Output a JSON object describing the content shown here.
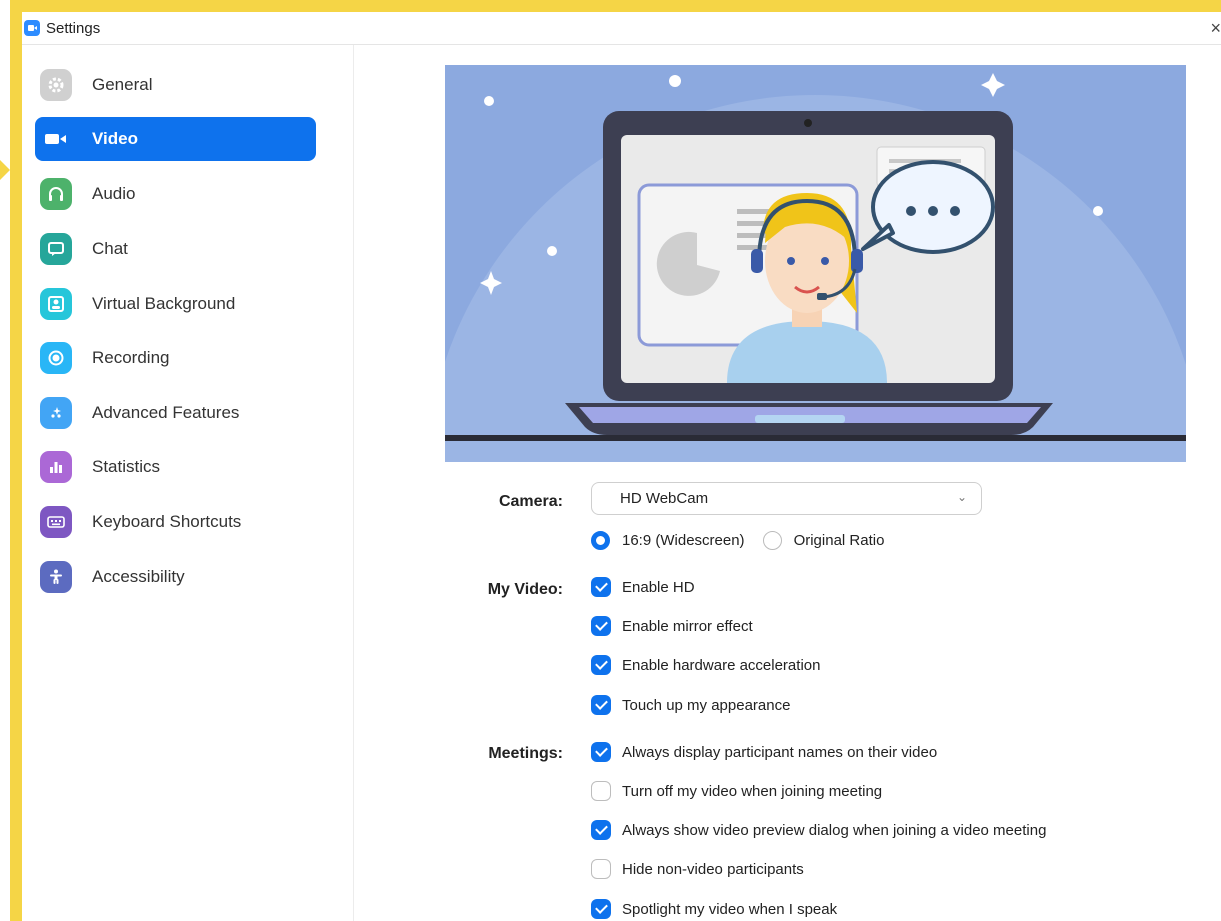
{
  "window": {
    "title": "Settings",
    "close_glyph": "×"
  },
  "sidebar": {
    "items": [
      {
        "label": "General",
        "icon": "gear-icon",
        "color": "#c8c8c8",
        "active": false
      },
      {
        "label": "Video",
        "icon": "video-camera-icon",
        "color": "#0e72ed",
        "active": true
      },
      {
        "label": "Audio",
        "icon": "headphones-icon",
        "color": "#4db26b",
        "active": false
      },
      {
        "label": "Chat",
        "icon": "chat-bubble-icon",
        "color": "#26a69a",
        "active": false
      },
      {
        "label": "Virtual Background",
        "icon": "person-frame-icon",
        "color": "#26c6da",
        "active": false
      },
      {
        "label": "Recording",
        "icon": "record-icon",
        "color": "#29b6f6",
        "active": false
      },
      {
        "label": "Advanced Features",
        "icon": "sparkle-icon",
        "color": "#42a5f5",
        "active": false
      },
      {
        "label": "Statistics",
        "icon": "bar-chart-icon",
        "color": "#ab68d6",
        "active": false
      },
      {
        "label": "Keyboard Shortcuts",
        "icon": "keyboard-icon",
        "color": "#7e57c2",
        "active": false
      },
      {
        "label": "Accessibility",
        "icon": "accessibility-icon",
        "color": "#5c6bc0",
        "active": false
      }
    ]
  },
  "camera": {
    "label": "Camera:",
    "selected": "HD WebCam",
    "ratio_options": [
      {
        "label": "16:9 (Widescreen)",
        "selected": true
      },
      {
        "label": "Original Ratio",
        "selected": false
      }
    ]
  },
  "my_video": {
    "label": "My Video:",
    "options": [
      {
        "label": "Enable HD",
        "checked": true
      },
      {
        "label": "Enable mirror effect",
        "checked": true
      },
      {
        "label": "Enable hardware acceleration",
        "checked": true
      },
      {
        "label": "Touch up my appearance",
        "checked": true
      }
    ]
  },
  "meetings": {
    "label": "Meetings:",
    "options": [
      {
        "label": "Always display participant names on their video",
        "checked": true
      },
      {
        "label": "Turn off my video when joining meeting",
        "checked": false
      },
      {
        "label": "Always show video preview dialog when joining a video meeting",
        "checked": true
      },
      {
        "label": "Hide non-video participants",
        "checked": false
      },
      {
        "label": "Spotlight my video when I speak",
        "checked": true
      }
    ]
  },
  "colors": {
    "accent": "#0e72ed",
    "highlight_frame": "#f5d546",
    "illustration_bg": "#8ca9df"
  }
}
